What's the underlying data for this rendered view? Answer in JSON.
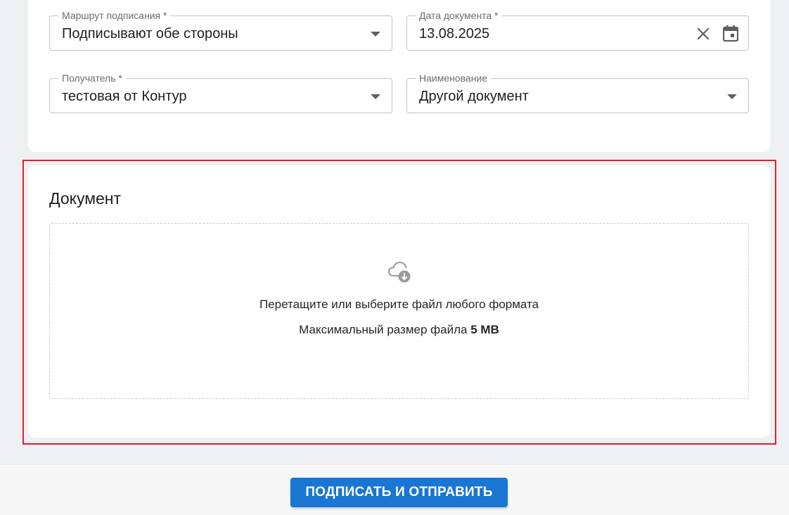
{
  "form": {
    "route": {
      "label": "Маршрут подписания *",
      "value": "Подписывают обе стороны"
    },
    "date": {
      "label": "Дата документа *",
      "value": "13.08.2025"
    },
    "recipient": {
      "label": "Получатель *",
      "value": "тестовая от Контур"
    },
    "name": {
      "label": "Наименование",
      "value": "Другой документ"
    }
  },
  "document": {
    "title": "Документ",
    "dropzone": {
      "instruction": "Перетащите или выберите файл любого формата",
      "max_size_prefix": "Максимальный размер файла ",
      "max_size_value": "5 MB"
    }
  },
  "actions": {
    "submit_label": "ПОДПИСАТЬ И ОТПРАВИТЬ"
  },
  "colors": {
    "primary": "#1976d2",
    "highlight": "#e0202c",
    "background": "#eef0f4"
  },
  "icons": [
    "chevron-down-icon",
    "clear-icon",
    "calendar-icon",
    "cloud-upload-icon"
  ]
}
